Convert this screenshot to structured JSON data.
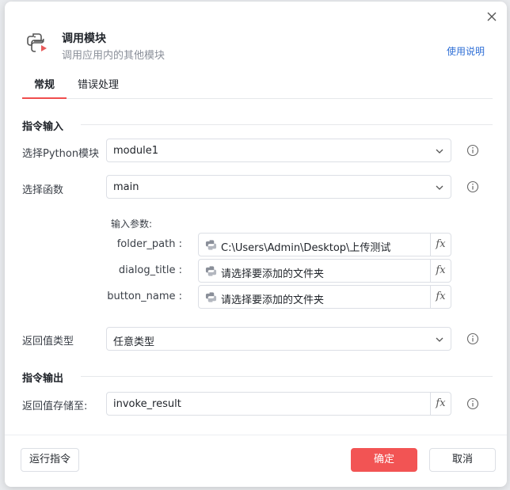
{
  "header": {
    "title": "调用模块",
    "subtitle": "调用应用内的其他模块",
    "help_link": "使用说明",
    "icon": "python-module-icon"
  },
  "tabs": [
    {
      "label": "常规",
      "active": true
    },
    {
      "label": "错误处理",
      "active": false
    }
  ],
  "input_section": {
    "title": "指令输入",
    "python_module": {
      "label": "选择Python模块",
      "value": "module1"
    },
    "function": {
      "label": "选择函数",
      "value": "main"
    },
    "params_title": "输入参数:",
    "params": [
      {
        "name": "folder_path :",
        "value": "C:\\Users\\Admin\\Desktop\\上传测试"
      },
      {
        "name": "dialog_title :",
        "value": "请选择要添加的文件夹"
      },
      {
        "name": "button_name :",
        "value": "请选择要添加的文件夹"
      }
    ],
    "return_type": {
      "label": "返回值类型",
      "value": "任意类型"
    }
  },
  "output_section": {
    "title": "指令输出",
    "store_label": "返回值存储至:",
    "store_value": "invoke_result"
  },
  "fx_label": "fx",
  "footer": {
    "run_label": "运行指令",
    "ok_label": "确定",
    "cancel_label": "取消"
  },
  "colors": {
    "accent": "#f25454",
    "link": "#2f6fd6",
    "tab_indicator": "#f04d4d"
  }
}
